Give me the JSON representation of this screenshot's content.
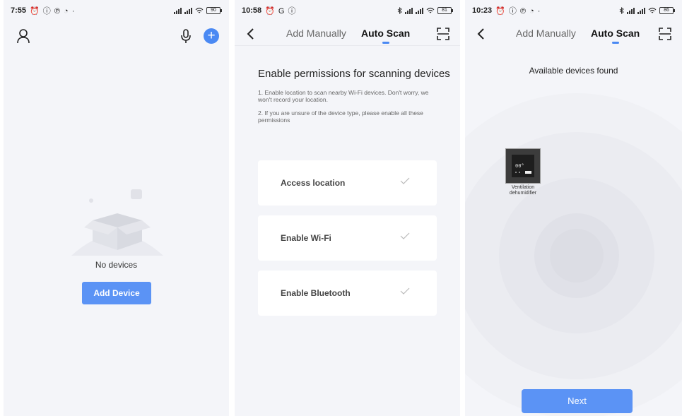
{
  "screen1": {
    "status": {
      "time": "7:55",
      "icons": "⏰ ⓘ ℗ ◔ ·",
      "battery": "90"
    },
    "no_devices": "No devices",
    "add_device_label": "Add Device"
  },
  "screen2": {
    "status": {
      "time": "10:58",
      "icons": "⏰ G ⓘ",
      "battery": "81"
    },
    "tabs": {
      "manual": "Add Manually",
      "auto": "Auto Scan"
    },
    "heading": "Enable permissions for scanning devices",
    "note1": "1. Enable location to scan nearby Wi-Fi devices. Don't worry, we won't record your location.",
    "note2": "2. If you are unsure of the device type, please enable all these permissions",
    "permissions": [
      {
        "label": "Access location"
      },
      {
        "label": "Enable Wi-Fi"
      },
      {
        "label": "Enable Bluetooth"
      }
    ]
  },
  "screen3": {
    "status": {
      "time": "10:23",
      "icons": "⏰ ⓘ ℗ ◔ ·",
      "battery": "86"
    },
    "tabs": {
      "manual": "Add Manually",
      "auto": "Auto Scan"
    },
    "found_title": "Available devices found",
    "device_name": "Ventilation dehumidifier",
    "next_label": "Next"
  },
  "colors": {
    "accent": "#4a89f3",
    "button": "#5b93f5",
    "background": "#f4f5f9"
  },
  "icons": [
    "user-icon",
    "microphone-icon",
    "plus-icon",
    "back-arrow-icon",
    "scan-icon",
    "check-icon",
    "bluetooth-icon",
    "wifi-icon",
    "signal-icon",
    "battery-icon"
  ]
}
